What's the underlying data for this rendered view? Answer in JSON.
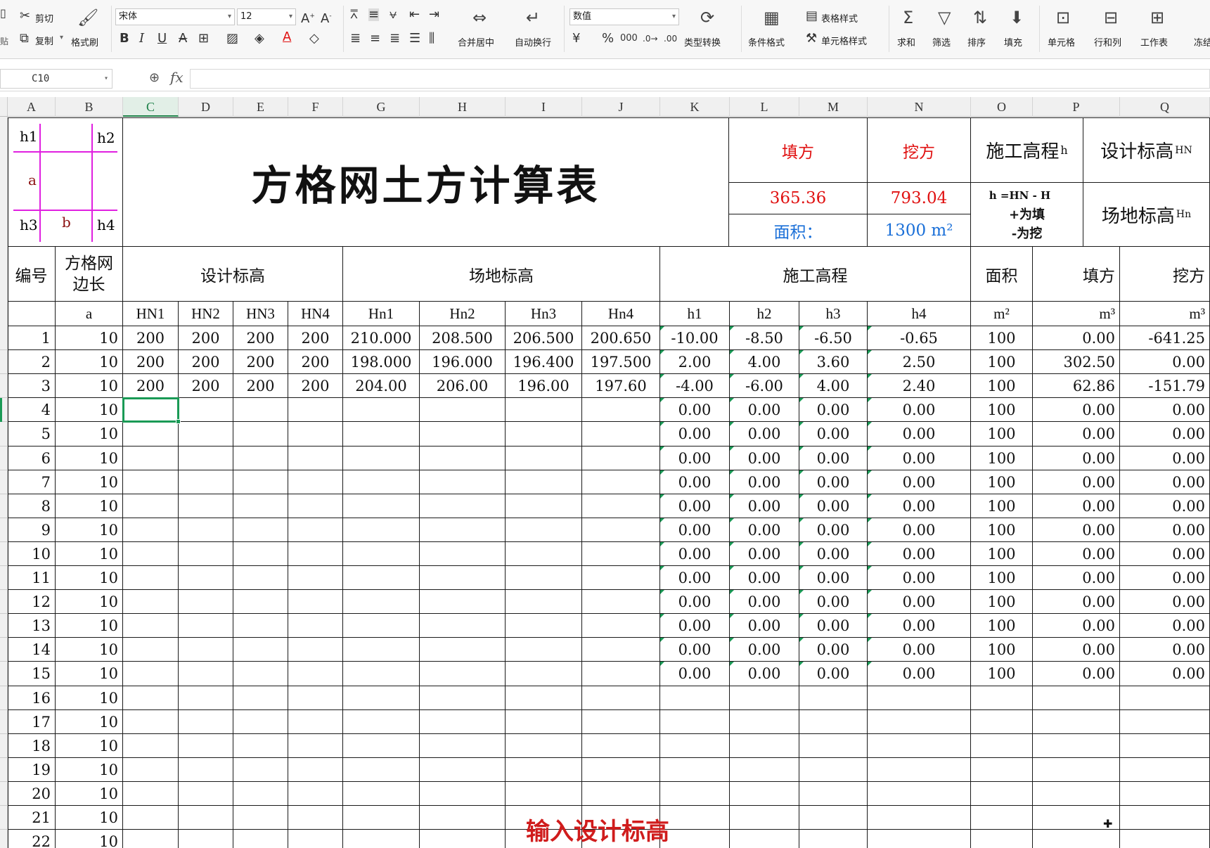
{
  "ribbon": {
    "clipboard": {
      "cut": "剪切",
      "copy": "复制",
      "format_painter": "格式刷",
      "paste_partial": "贴"
    },
    "font": {
      "name": "宋体",
      "size": "12"
    },
    "alignment": {
      "merge_center": "合并居中",
      "wrap": "自动换行"
    },
    "number": {
      "format": "数值",
      "type_convert": "类型转换"
    },
    "styles": {
      "conditional_format": "条件格式",
      "table_style": "表格样式",
      "cell_style": "单元格样式"
    },
    "editing": {
      "sum": "求和",
      "filter": "筛选",
      "sort": "排序",
      "fill": "填充",
      "cell": "单元格",
      "row_col": "行和列",
      "worksheet": "工作表",
      "freeze_partial": "冻结"
    }
  },
  "formula_bar": {
    "name_box": "C10",
    "fx": "fx",
    "value": ""
  },
  "columns": [
    "A",
    "B",
    "C",
    "D",
    "E",
    "F",
    "G",
    "H",
    "I",
    "J",
    "K",
    "L",
    "M",
    "N",
    "O",
    "P",
    "Q"
  ],
  "selected_column": "C",
  "sheet": {
    "title": "方格网土方计算表",
    "diagram": {
      "h1": "h1",
      "h2": "h2",
      "h3": "h3",
      "h4": "h4",
      "a": "a",
      "b": "b"
    },
    "summary": {
      "fill_label": "填方",
      "cut_label": "挖方",
      "fill_value": "365.36",
      "cut_value": "793.04",
      "area_label": "面积：",
      "area_value": "1300 m²"
    },
    "legend": {
      "construction_height": "施工高程",
      "construction_sub": "h",
      "design_elev": "设计标高",
      "design_sub": "HN",
      "formula": "h =HN - H",
      "plus": "+为填",
      "minus": "-为挖",
      "site_elev": "场地标高",
      "site_sub": "Hn"
    },
    "headers": {
      "no": "编号",
      "side": "方格网边长",
      "design": "设计标高",
      "site": "场地标高",
      "construction": "施工高程",
      "area": "面积",
      "fill": "填方",
      "cut": "挖方"
    },
    "subheaders": [
      "",
      "a",
      "HN1",
      "HN2",
      "HN3",
      "HN4",
      "Hn1",
      "Hn2",
      "Hn3",
      "Hn4",
      "h1",
      "h2",
      "h3",
      "h4",
      "m²",
      "m³",
      "m³"
    ],
    "rows": [
      [
        "1",
        "10",
        "200",
        "200",
        "200",
        "200",
        "210.000",
        "208.500",
        "206.500",
        "200.650",
        "-10.00",
        "-8.50",
        "-6.50",
        "-0.65",
        "100",
        "0.00",
        "-641.25"
      ],
      [
        "2",
        "10",
        "200",
        "200",
        "200",
        "200",
        "198.000",
        "196.000",
        "196.400",
        "197.500",
        "2.00",
        "4.00",
        "3.60",
        "2.50",
        "100",
        "302.50",
        "0.00"
      ],
      [
        "3",
        "10",
        "200",
        "200",
        "200",
        "200",
        "204.00",
        "206.00",
        "196.00",
        "197.60",
        "-4.00",
        "-6.00",
        "4.00",
        "2.40",
        "100",
        "62.86",
        "-151.79"
      ],
      [
        "4",
        "10",
        "",
        "",
        "",
        "",
        "",
        "",
        "",
        "",
        "0.00",
        "0.00",
        "0.00",
        "0.00",
        "100",
        "0.00",
        "0.00"
      ],
      [
        "5",
        "10",
        "",
        "",
        "",
        "",
        "",
        "",
        "",
        "",
        "0.00",
        "0.00",
        "0.00",
        "0.00",
        "100",
        "0.00",
        "0.00"
      ],
      [
        "6",
        "10",
        "",
        "",
        "",
        "",
        "",
        "",
        "",
        "",
        "0.00",
        "0.00",
        "0.00",
        "0.00",
        "100",
        "0.00",
        "0.00"
      ],
      [
        "7",
        "10",
        "",
        "",
        "",
        "",
        "",
        "",
        "",
        "",
        "0.00",
        "0.00",
        "0.00",
        "0.00",
        "100",
        "0.00",
        "0.00"
      ],
      [
        "8",
        "10",
        "",
        "",
        "",
        "",
        "",
        "",
        "",
        "",
        "0.00",
        "0.00",
        "0.00",
        "0.00",
        "100",
        "0.00",
        "0.00"
      ],
      [
        "9",
        "10",
        "",
        "",
        "",
        "",
        "",
        "",
        "",
        "",
        "0.00",
        "0.00",
        "0.00",
        "0.00",
        "100",
        "0.00",
        "0.00"
      ],
      [
        "10",
        "10",
        "",
        "",
        "",
        "",
        "",
        "",
        "",
        "",
        "0.00",
        "0.00",
        "0.00",
        "0.00",
        "100",
        "0.00",
        "0.00"
      ],
      [
        "11",
        "10",
        "",
        "",
        "",
        "",
        "",
        "",
        "",
        "",
        "0.00",
        "0.00",
        "0.00",
        "0.00",
        "100",
        "0.00",
        "0.00"
      ],
      [
        "12",
        "10",
        "",
        "",
        "",
        "",
        "",
        "",
        "",
        "",
        "0.00",
        "0.00",
        "0.00",
        "0.00",
        "100",
        "0.00",
        "0.00"
      ],
      [
        "13",
        "10",
        "",
        "",
        "",
        "",
        "",
        "",
        "",
        "",
        "0.00",
        "0.00",
        "0.00",
        "0.00",
        "100",
        "0.00",
        "0.00"
      ],
      [
        "14",
        "10",
        "",
        "",
        "",
        "",
        "",
        "",
        "",
        "",
        "0.00",
        "0.00",
        "0.00",
        "0.00",
        "100",
        "0.00",
        "0.00"
      ],
      [
        "15",
        "10",
        "",
        "",
        "",
        "",
        "",
        "",
        "",
        "",
        "0.00",
        "0.00",
        "0.00",
        "0.00",
        "100",
        "0.00",
        "0.00"
      ],
      [
        "16",
        "10",
        "",
        "",
        "",
        "",
        "",
        "",
        "",
        "",
        "",
        "",
        "",
        "",
        "",
        "",
        ""
      ],
      [
        "17",
        "10",
        "",
        "",
        "",
        "",
        "",
        "",
        "",
        "",
        "",
        "",
        "",
        "",
        "",
        "",
        ""
      ],
      [
        "18",
        "10",
        "",
        "",
        "",
        "",
        "",
        "",
        "",
        "",
        "",
        "",
        "",
        "",
        "",
        "",
        ""
      ],
      [
        "19",
        "10",
        "",
        "",
        "",
        "",
        "",
        "",
        "",
        "",
        "",
        "",
        "",
        "",
        "",
        "",
        ""
      ],
      [
        "20",
        "10",
        "",
        "",
        "",
        "",
        "",
        "",
        "",
        "",
        "",
        "",
        "",
        "",
        "",
        "",
        ""
      ],
      [
        "21",
        "10",
        "",
        "",
        "",
        "",
        "",
        "",
        "",
        "",
        "",
        "",
        "",
        "",
        "",
        "",
        ""
      ],
      [
        "22",
        "10",
        "",
        "",
        "",
        "",
        "",
        "",
        "",
        "",
        "",
        "",
        "",
        "",
        "",
        "",
        ""
      ]
    ]
  },
  "caption": "输入设计标高",
  "colors": {
    "accent_green": "#1a9a56",
    "red": "#e01010",
    "blue": "#1a6fd8",
    "magenta": "#e020e0",
    "caption_red": "#d01c1c"
  }
}
